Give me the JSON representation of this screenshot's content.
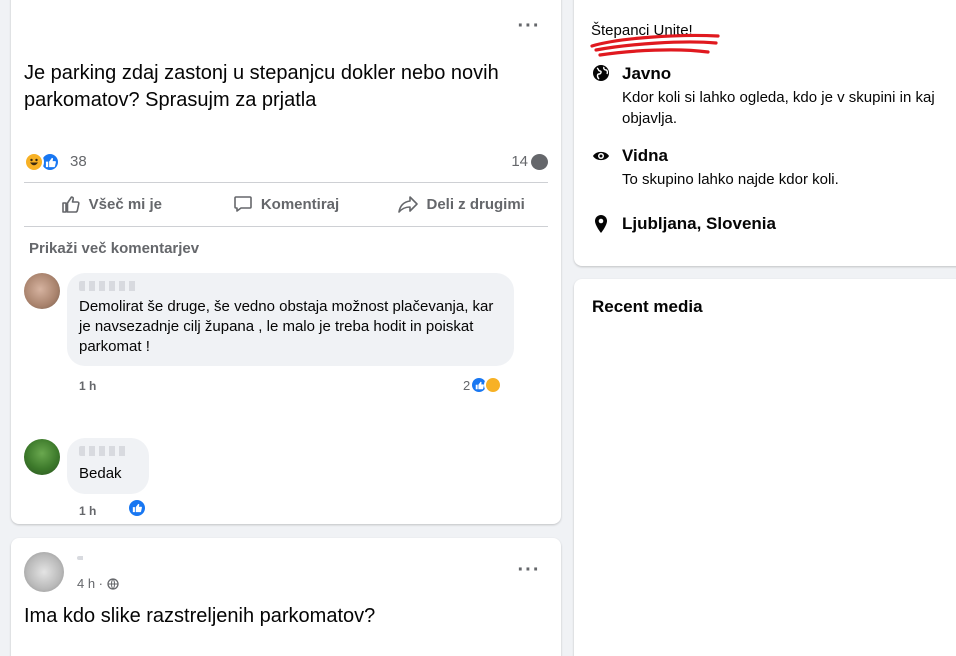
{
  "post1": {
    "title": "Je parking zdaj zastonj u stepanjcu dokler nebo novih parkomatov? Sprasujm za prjatla",
    "reactions_count": "38",
    "comments_count": "14",
    "actions": {
      "like": "Všeč mi je",
      "comment": "Komentiraj",
      "share": "Deli z drugimi"
    },
    "more_comments": "Prikaži več komentarjev",
    "comments": [
      {
        "text": "Demolirat še druge, še vedno obstaja možnost plačevanja, kar je navsezadnje cilj župana , le malo je treba hodit in poiskat parkomat !",
        "time": "1 h",
        "reaction_count": "2"
      },
      {
        "text": "Bedak",
        "time": "1 h"
      }
    ]
  },
  "post2": {
    "time": "4 h ·",
    "title": "Ima kdo slike razstreljenih parkomatov?"
  },
  "about": {
    "group_name": "Štepanci Unite!",
    "items": [
      {
        "icon": "globe-icon",
        "title": "Javno",
        "desc": "Kdor koli si lahko ogleda, kdo je v skupini in kaj objavlja."
      },
      {
        "icon": "eye-icon",
        "title": "Vidna",
        "desc": "To skupino lahko najde kdor koli."
      },
      {
        "icon": "location-pin-icon",
        "title": "Ljubljana, Slovenia"
      }
    ]
  },
  "media": {
    "title": "Recent media"
  },
  "colors": {
    "accent": "#1877f2",
    "scribble": "#e0191f",
    "secondary_text": "#65676b"
  }
}
